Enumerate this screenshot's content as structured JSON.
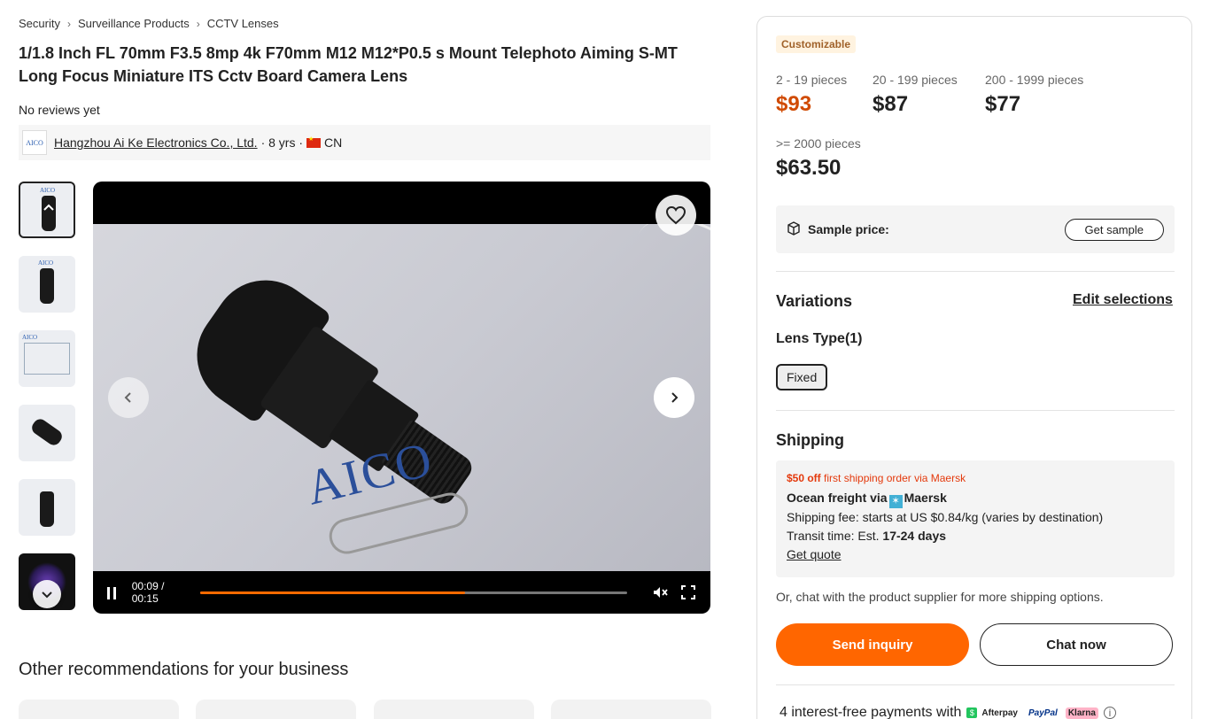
{
  "breadcrumb": [
    "Security",
    "Surveillance Products",
    "CCTV Lenses"
  ],
  "product": {
    "title": "1/1.8 Inch FL 70mm F3.5 8mp 4k F70mm M12 M12*P0.5 s Mount Telephoto Aiming S-MT Long Focus Miniature ITS Cctv Board Camera Lens",
    "reviews": "No reviews yet"
  },
  "supplier": {
    "logo": "AICO",
    "name": "Hangzhou Ai Ke Electronics Co., Ltd.",
    "years": "· 8 yrs ·",
    "country": "CN"
  },
  "thumbnails": [
    "thumb-1",
    "thumb-2",
    "thumb-3",
    "thumb-4",
    "thumb-5",
    "thumb-6"
  ],
  "video": {
    "brand_text": "AICO",
    "time_current": "00:09",
    "time_total": "00:15",
    "progress": 0.62
  },
  "recommendations": {
    "title": "Other recommendations for your business"
  },
  "panel": {
    "badge": "Customizable",
    "tiers": [
      {
        "qty": "2 - 19 pieces",
        "price": "$93"
      },
      {
        "qty": "20 - 199 pieces",
        "price": "$87"
      },
      {
        "qty": "200 - 1999 pieces",
        "price": "$77"
      },
      {
        "qty": ">= 2000 pieces",
        "price": "$63.50"
      }
    ],
    "sample_label": "Sample price:",
    "get_sample": "Get sample",
    "variations_title": "Variations",
    "edit_selections": "Edit selections",
    "lens_type_label": "Lens Type(1)",
    "lens_type_option": "Fixed",
    "shipping_title": "Shipping",
    "shipping": {
      "discount_amount": "$50 off",
      "discount_text": "first shipping order via Maersk",
      "method_prefix": "Ocean freight via",
      "carrier": "Maersk",
      "fee": "Shipping fee: starts at US $0.84/kg (varies by destination)",
      "transit_prefix": "Transit time: Est.",
      "transit_days": "17-24 days",
      "get_quote": "Get quote"
    },
    "chat_note": "Or, chat with the product supplier for more shipping options.",
    "send_inquiry": "Send inquiry",
    "chat_now": "Chat now",
    "payments_text": "4 interest-free payments with",
    "payment_logos": [
      "Afterpay",
      "PayPal",
      "Klarna"
    ]
  },
  "colors": {
    "accent": "#ff6600",
    "price_highlight": "#d04a02",
    "badge_bg": "#fff3e0",
    "discount": "#e4390c"
  }
}
